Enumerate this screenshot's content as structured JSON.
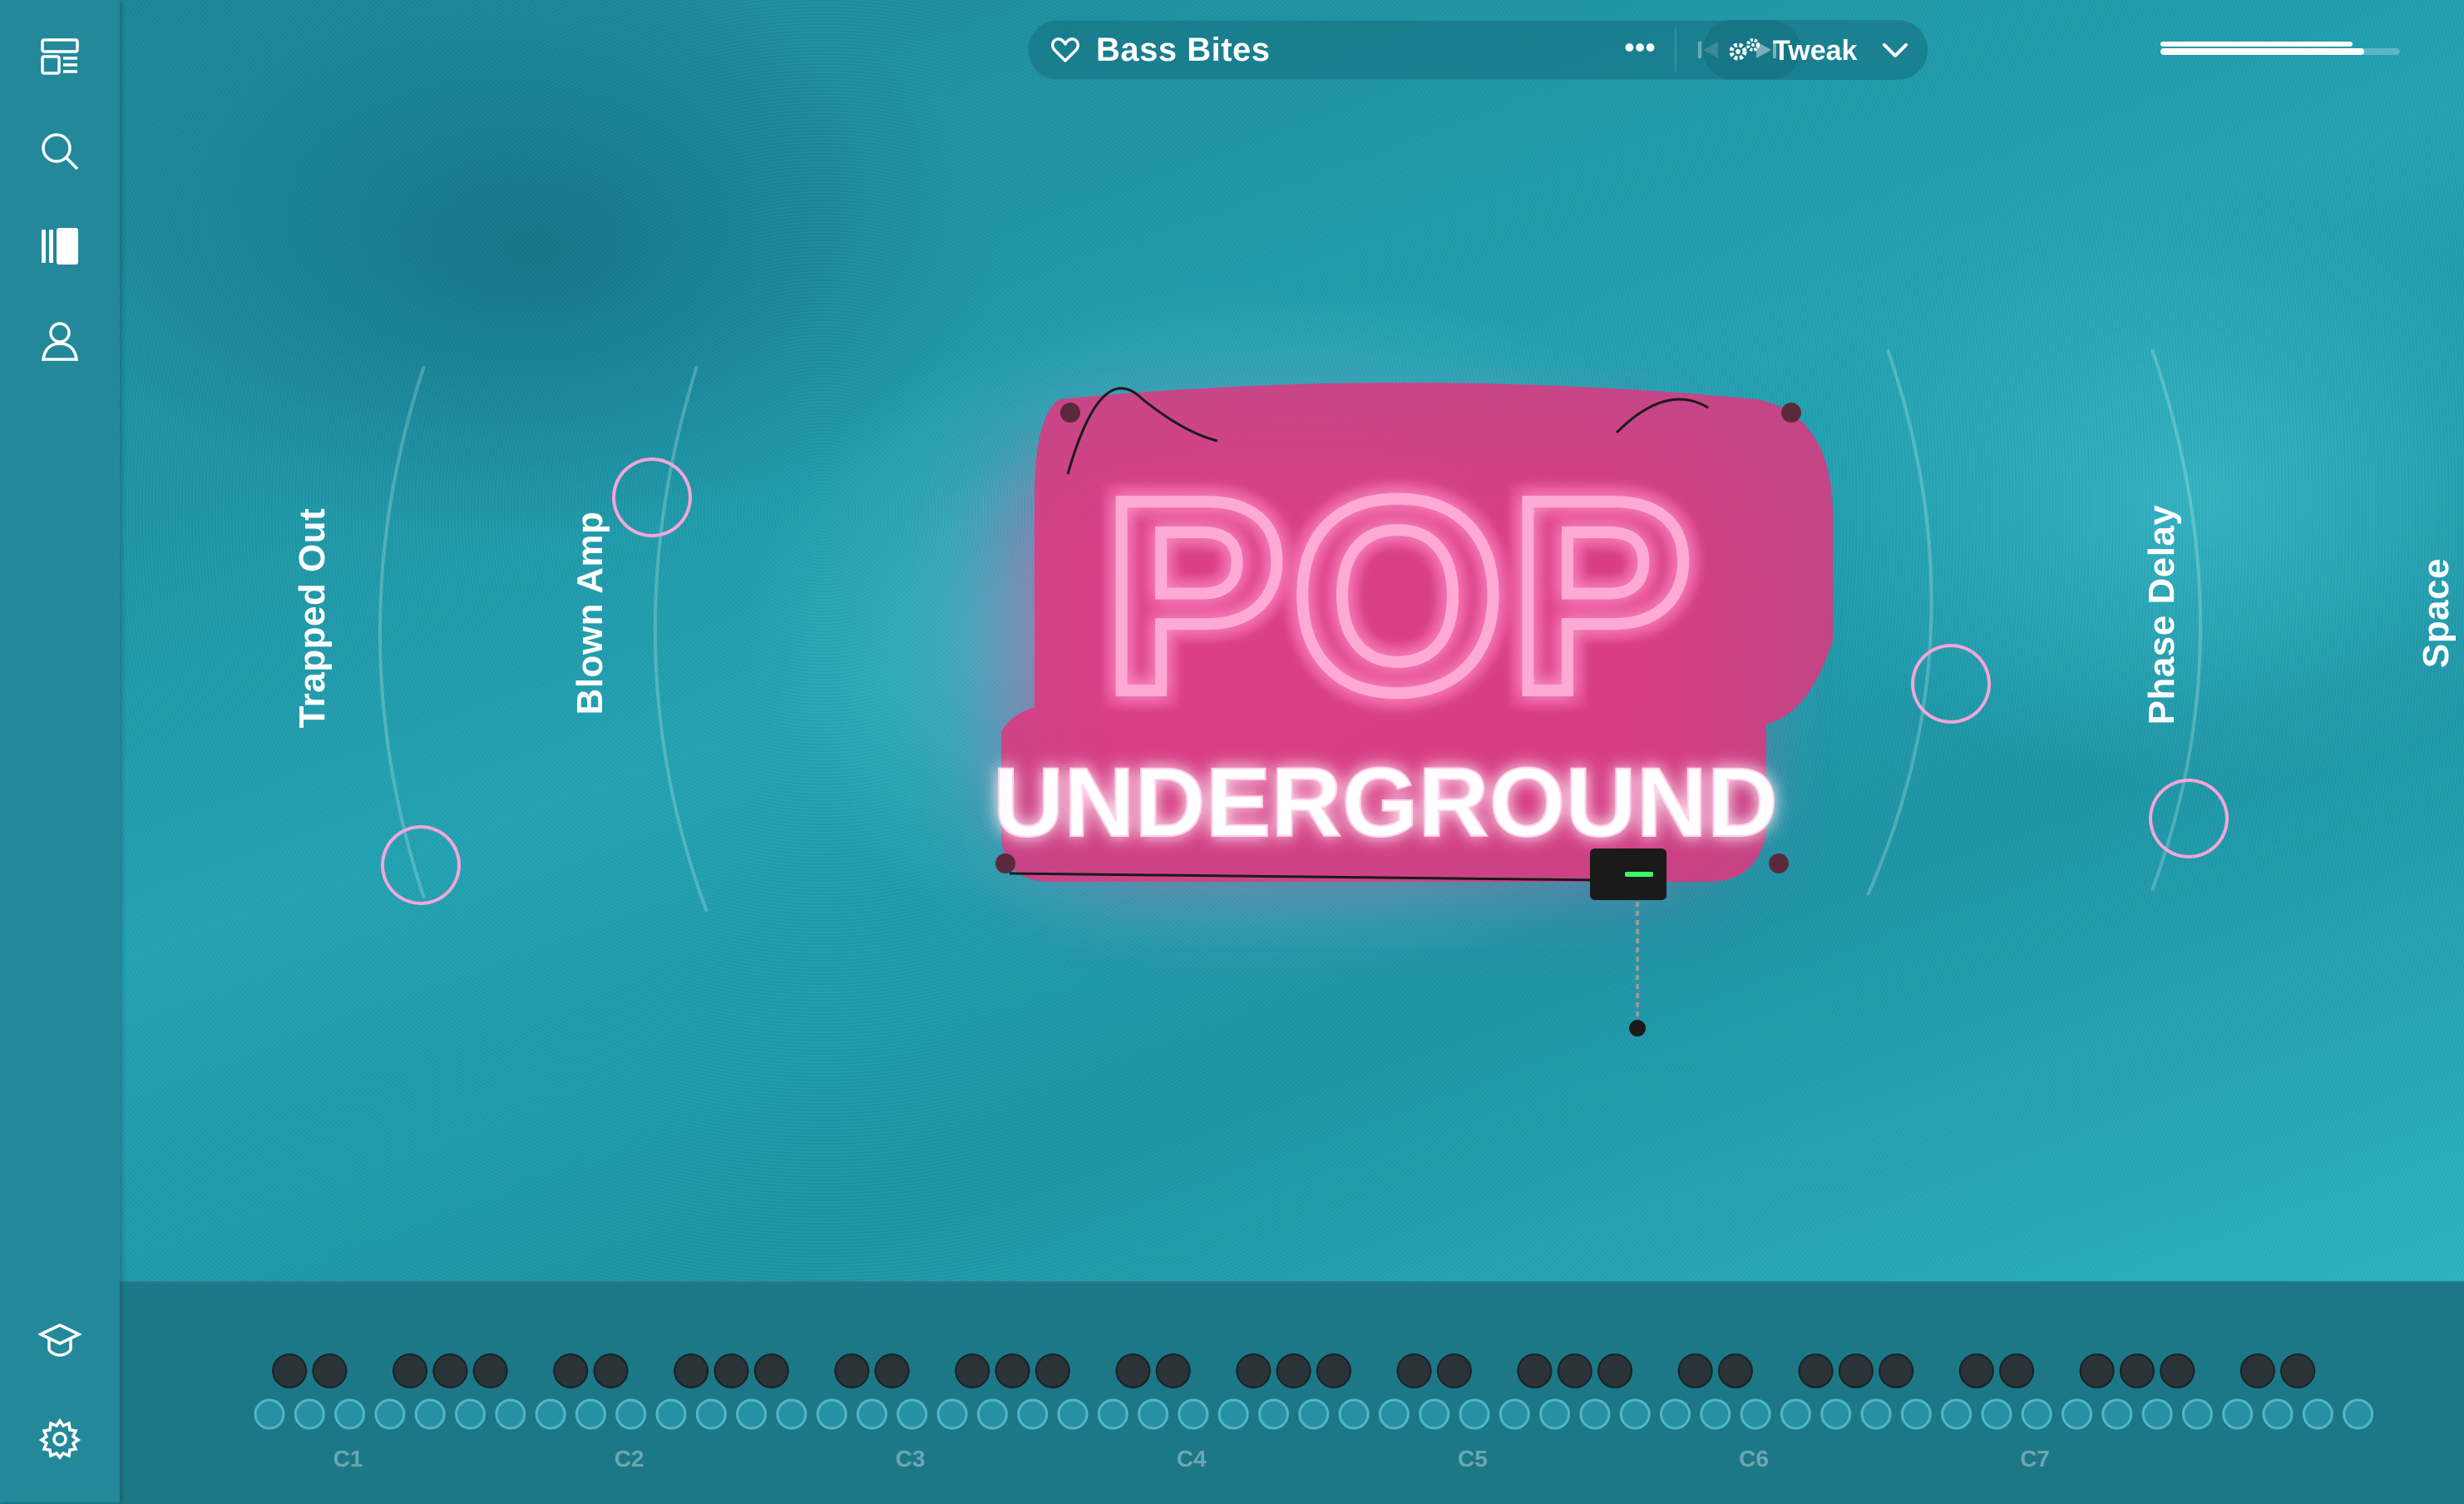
{
  "preset": {
    "name": "Bass Bites",
    "more_glyph": "•••"
  },
  "tweak": {
    "label": "Tweak"
  },
  "volume": {
    "level": 0.85
  },
  "sidebar": {
    "items": [
      {
        "name": "layout-icon"
      },
      {
        "name": "search-icon"
      },
      {
        "name": "library-icon"
      },
      {
        "name": "user-icon"
      }
    ],
    "bottom_items": [
      {
        "name": "learn-icon"
      },
      {
        "name": "settings-icon"
      }
    ]
  },
  "effects": [
    {
      "label": "Trapped Out"
    },
    {
      "label": "Blown Amp"
    },
    {
      "label": "Phase Delay"
    },
    {
      "label": "Space"
    }
  ],
  "sign": {
    "line1": "POP",
    "line2": "UNDERGROUND"
  },
  "keyboard": {
    "octave_labels": [
      "C1",
      "C2",
      "C3",
      "C4",
      "C5",
      "C6",
      "C7"
    ]
  },
  "colors": {
    "accent": "#f5a6d6",
    "neon": "#ff3d9a",
    "background": "#1f8fa0"
  }
}
